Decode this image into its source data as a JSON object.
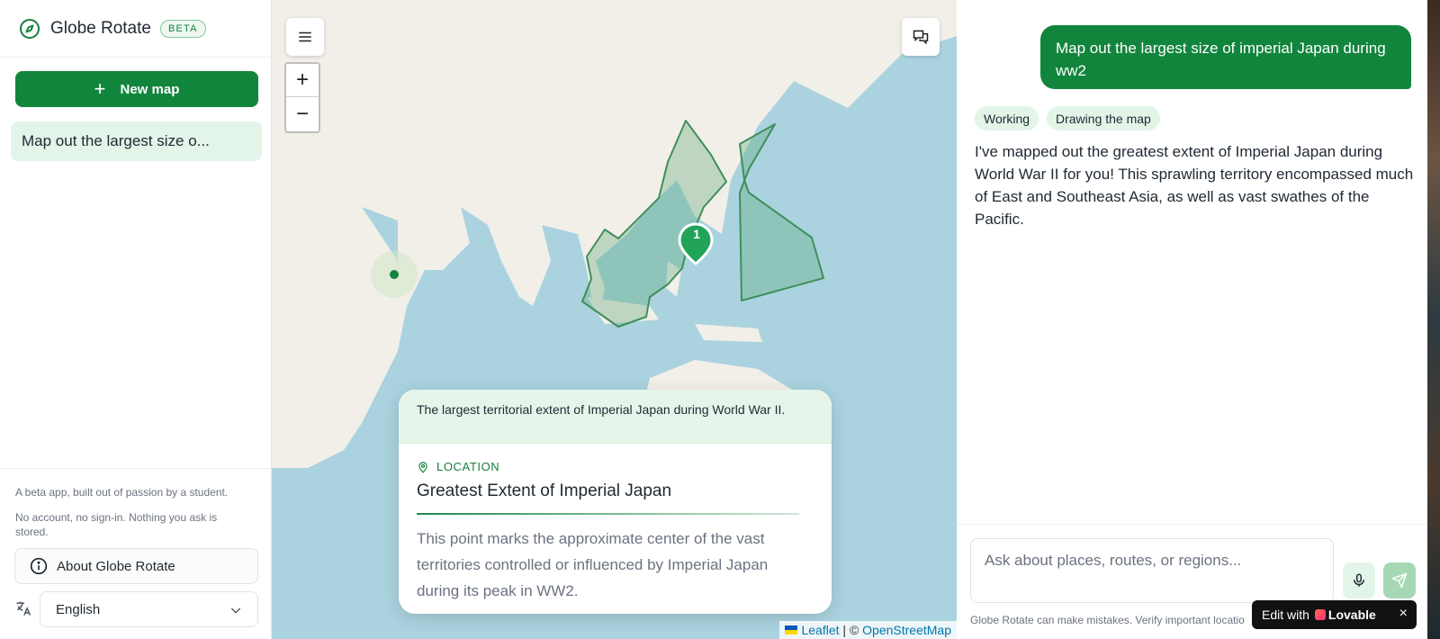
{
  "app": {
    "title": "Globe Rotate",
    "badge": "BETA"
  },
  "sidebar": {
    "new_map_label": "New map",
    "history": [
      "Map out the largest size o..."
    ],
    "footer_note_1": "A beta app, built out of passion by a student.",
    "footer_note_2": "No account, no sign-in. Nothing you ask is stored.",
    "about_label": "About Globe Rotate",
    "language_value": "English"
  },
  "map": {
    "zoom_in": "+",
    "zoom_out": "−",
    "marker_label": "1",
    "attribution_leaflet": "Leaflet",
    "attribution_sep": " | © ",
    "attribution_osm": "OpenStreetMap"
  },
  "info_card": {
    "header": "The largest territorial extent of Imperial Japan during World War II.",
    "kind": "LOCATION",
    "title": "Greatest Extent of Imperial Japan",
    "description": "This point marks the approximate center of the vast territories controlled or influenced by Imperial Japan during its peak in WW2."
  },
  "chat": {
    "user_message": "Map out the largest size of imperial Japan during ww2",
    "status_1": "Working",
    "status_2": "Drawing the map",
    "reply": "I've mapped out the greatest extent of Imperial Japan during World War II for you! This sprawling territory encompassed much of East and Southeast Asia, as well as vast swathes of the Pacific.",
    "input_placeholder": "Ask about places, routes, or regions...",
    "disclaimer": "Globe Rotate can make mistakes. Verify important locatio"
  },
  "lovable": {
    "prefix": "Edit with",
    "brand": "Lovable",
    "close": "×"
  },
  "colors": {
    "accent": "#12853d",
    "accent_light": "#e3f4e8",
    "water": "#aad3df",
    "land": "#f2efe9",
    "polygon": "#3f8f5a"
  }
}
